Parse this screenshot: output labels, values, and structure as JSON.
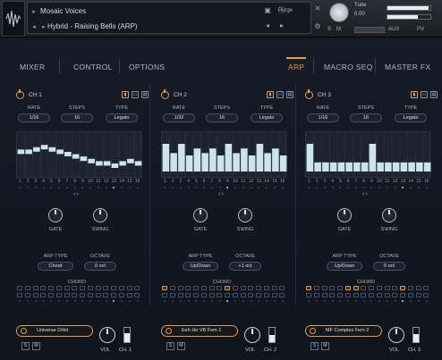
{
  "header": {
    "instrument_name": "Mosaic Voices",
    "preset_name": "Hybrid - Raising Bells (ARP)",
    "purge_label": "Purge",
    "tune_label": "Tune",
    "tune_value": "0.00",
    "s_label": "S",
    "m_label": "M",
    "aux_label": "AUX",
    "pv_label": "PV",
    "meter_levels": [
      0.95,
      0.7
    ]
  },
  "nav": {
    "left": [
      "MIXER",
      "CONTROL",
      "OPTIONS"
    ],
    "right": [
      "ARP",
      "MACRO SEQ",
      "MASTER FX"
    ],
    "active": "ARP"
  },
  "labels": {
    "rate": "RATE",
    "steps": "STEPS",
    "type": "TYPE",
    "gate": "GATE",
    "swing": "SWING",
    "arp_type": "ARP TYPE",
    "octave": "OCTAVE",
    "chord": "CHORD",
    "vol": "VOL"
  },
  "step_numbers": [
    "1",
    "2",
    "3",
    "4",
    "5",
    "6",
    "7",
    "8",
    "9",
    "10",
    "11",
    "12",
    "13",
    "14",
    "15",
    "16"
  ],
  "channels": [
    {
      "name": "CH 1",
      "rate": "1/16",
      "steps": "16",
      "type": "Legato",
      "arp_type": "Chord",
      "octave": "0 oct",
      "preset": "Universe Orbit",
      "channel_label": "CH. 1",
      "step_values": [
        0.55,
        0.55,
        0.6,
        0.65,
        0.6,
        0.55,
        0.5,
        0.45,
        0.4,
        0.35,
        0.3,
        0.3,
        0.25,
        0.3,
        0.35,
        0.3
      ],
      "step_dots_on": [
        12
      ],
      "chord_on": [],
      "chord_dots_on": [
        12
      ],
      "volume_level": 0.65
    },
    {
      "name": "CH 2",
      "rate": "1/32",
      "steps": "16",
      "type": "Legato",
      "arp_type": "Up/Down",
      "octave": "+1 oct",
      "preset": "Eeh Ho VB Fem 1",
      "channel_label": "CH. 2",
      "step_values": [
        0.75,
        0.55,
        0.75,
        0.5,
        0.65,
        0.55,
        0.65,
        0.5,
        0.75,
        0.55,
        0.65,
        0.5,
        0.75,
        0.55,
        0.65,
        0.5
      ],
      "step_dots_on": [
        8
      ],
      "chord_on": [
        0,
        8
      ],
      "chord_dots_on": [
        8
      ],
      "volume_level": 0.5
    },
    {
      "name": "CH 3",
      "rate": "1/16",
      "steps": "16",
      "type": "Legato",
      "arp_type": "Up/Down",
      "octave": "0 oct",
      "preset": "MF Complex Fem 2",
      "channel_label": "CH. 3",
      "step_values": [
        0.75,
        0.35,
        0.35,
        0.35,
        0.35,
        0.35,
        0.35,
        0.35,
        0.75,
        0.35,
        0.35,
        0.35,
        0.35,
        0.35,
        0.35,
        0.35
      ],
      "step_dots_on": [
        12
      ],
      "chord_on": [
        0,
        5,
        6,
        12
      ],
      "chord_dots_on": [
        12
      ],
      "volume_level": 0.55
    }
  ],
  "colors": {
    "accent": "#e39a55",
    "bar": "#cfe3ef",
    "background": "#121722"
  }
}
